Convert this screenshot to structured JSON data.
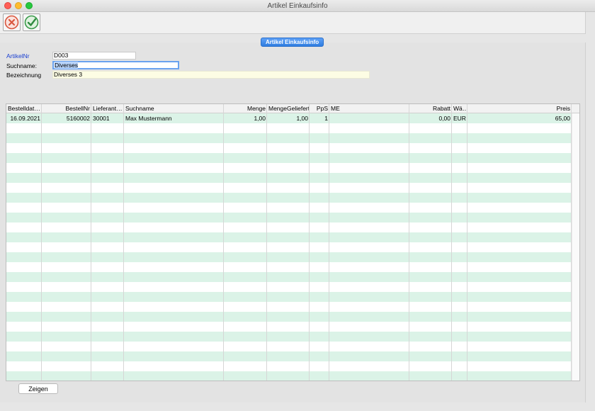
{
  "window": {
    "title": "Artikel Einkaufsinfo"
  },
  "toolbar": {
    "cancel_icon": "cancel-circle-icon",
    "ok_icon": "checkmark-circle-icon"
  },
  "tab": {
    "label": "Artikel Einkaufsinfo"
  },
  "form": {
    "artikelnr_label": "ArtikelNr",
    "artikelnr_value": "D003",
    "suchname_label": "Suchname:",
    "suchname_value": "Diverses",
    "bezeichnung_label": "Bezeichnung",
    "bezeichnung_value": "Diverses 3"
  },
  "table": {
    "headers": {
      "bestelldatum": "Bestelldat…",
      "bestellnr": "BestellNr",
      "lieferant": "Lieferant…",
      "suchname": "Suchname",
      "menge": "Menge",
      "mengegeliefert": "MengeGeliefert",
      "pps": "PpS",
      "me": "ME",
      "rabatt": "Rabatt",
      "waehrung": "Wä…",
      "preis": "Preis"
    },
    "rows": [
      {
        "bestelldatum": "16.09.2021",
        "bestellnr": "5160002",
        "lieferant": "30001",
        "suchname": "Max Mustermann",
        "menge": "1,00",
        "mengegeliefert": "1,00",
        "pps": "1",
        "me": "",
        "rabatt": "0,00",
        "waehrung": "EUR",
        "preis": "65,00"
      }
    ]
  },
  "buttons": {
    "show_label": "Zeigen"
  },
  "colors": {
    "row_alt": "#dbf3e7",
    "accent": "#2f7de0",
    "link": "#1a3fd0"
  }
}
